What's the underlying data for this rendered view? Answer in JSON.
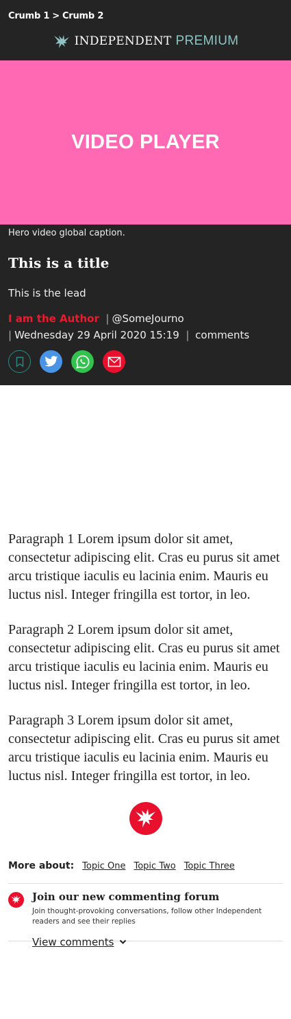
{
  "breadcrumb": {
    "items": [
      "Crumb 1",
      "Crumb 2"
    ],
    "separator": ">"
  },
  "logo": {
    "name": "INDEPENDENT",
    "suffix": "PREMIUM",
    "icon": "eagle-icon"
  },
  "video": {
    "label": "VIDEO PLAYER",
    "background": "#ff69b4"
  },
  "article": {
    "caption": "Hero video global caption.",
    "title": "This is a title",
    "lead": "This is the lead",
    "author": "I am the Author",
    "handle": "@SomeJourno",
    "date": "Wednesday 29 April 2020 15:19",
    "comments_label": "comments"
  },
  "share": {
    "bookmark": "bookmark-icon",
    "twitter": "twitter-icon",
    "whatsapp": "whatsapp-icon",
    "email": "email-icon"
  },
  "paragraphs": [
    "Paragraph 1 Lorem ipsum dolor sit amet, consectetur adipiscing elit. Cras eu purus sit amet arcu tristique iaculis eu lacinia enim. Mauris eu luctus nisl. Integer fringilla est tortor, in leo.",
    "Paragraph 2 Lorem ipsum dolor sit amet, consectetur adipiscing elit. Cras eu purus sit amet arcu tristique iaculis eu lacinia enim. Mauris eu luctus nisl. Integer fringilla est tortor, in leo.",
    "Paragraph 3 Lorem ipsum dolor sit amet, consectetur adipiscing elit. Cras eu purus sit amet arcu tristique iaculis eu lacinia enim. Mauris eu luctus nisl. Integer fringilla est tortor, in leo."
  ],
  "more_about": {
    "label": "More about:",
    "topics": [
      "Topic One",
      "Topic Two",
      "Topic Three"
    ]
  },
  "comments": {
    "title": "Join our new commenting forum",
    "description": "Join thought-provoking conversations, follow other Independent readers and see their replies",
    "link": "View comments"
  },
  "colors": {
    "header_bg": "#242424",
    "author_red": "#ec1a2e",
    "brand_red": "#e8102c",
    "premium_teal": "#8fc3c3"
  }
}
